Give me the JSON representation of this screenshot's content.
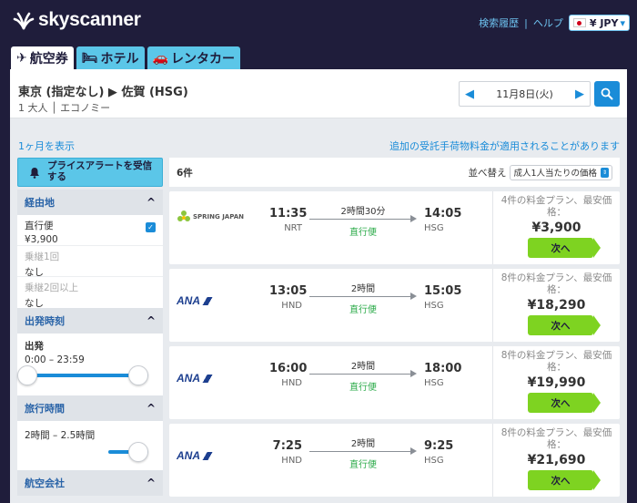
{
  "header": {
    "logo_text": "skyscanner",
    "links": [
      "検索履歴",
      "ヘルプ"
    ],
    "currency": "¥ JPY",
    "currency_caret": "▾"
  },
  "tabs": [
    {
      "label": "航空券",
      "icon": "airplane-icon",
      "glyph": "✈"
    },
    {
      "label": "ホテル",
      "icon": "bed-icon",
      "glyph": "🛏"
    },
    {
      "label": "レンタカー",
      "icon": "car-icon",
      "glyph": "🚗"
    }
  ],
  "search": {
    "route": "東京 (指定なし) ▶ 佐賀 (HSG)",
    "passengers": "1 大人 │ エコノミー",
    "date": "11月8日(火)",
    "prev": "◀",
    "next": "▶"
  },
  "links": {
    "month_view": "1ヶ月を表示",
    "baggage_note": "追加の受託手荷物料金が適用されることがあります"
  },
  "sidebar": {
    "alert_button": "プライスアラートを受信する",
    "stops": {
      "title": "経由地",
      "caret": "^",
      "options": [
        {
          "label": "直行便",
          "price": "¥3,900",
          "checked": true,
          "disabled": false
        },
        {
          "label": "乗継1回",
          "price": "なし",
          "checked": false,
          "disabled": true
        },
        {
          "label": "乗継2回以上",
          "price": "なし",
          "checked": false,
          "disabled": true
        }
      ]
    },
    "departure": {
      "title": "出発時刻",
      "caret": "^",
      "label": "出発",
      "range": "0:00 – 23:59"
    },
    "duration": {
      "title": "旅行時間",
      "caret": "^",
      "range": "2時間 – 2.5時間"
    },
    "airlines": {
      "title": "航空会社",
      "caret": "^"
    }
  },
  "results": {
    "count": "6件",
    "sort_label": "並べ替え",
    "sort_value": "成人1人当たりの価格",
    "flights": [
      {
        "airline": "SPRING JAPAN",
        "airline_logo": "spring",
        "dep_time": "11:35",
        "dep_code": "NRT",
        "duration": "2時間30分",
        "stops": "直行便",
        "arr_time": "14:05",
        "arr_code": "HSG",
        "plans": "4件の料金プラン、最安価格：",
        "price": "¥3,900",
        "button": "次へ"
      },
      {
        "airline": "ANA",
        "airline_logo": "ana",
        "dep_time": "13:05",
        "dep_code": "HND",
        "duration": "2時間",
        "stops": "直行便",
        "arr_time": "15:05",
        "arr_code": "HSG",
        "plans": "8件の料金プラン、最安価格：",
        "price": "¥18,290",
        "button": "次へ"
      },
      {
        "airline": "ANA",
        "airline_logo": "ana",
        "dep_time": "16:00",
        "dep_code": "HND",
        "duration": "2時間",
        "stops": "直行便",
        "arr_time": "18:00",
        "arr_code": "HSG",
        "plans": "8件の料金プラン、最安価格：",
        "price": "¥19,990",
        "button": "次へ"
      },
      {
        "airline": "ANA",
        "airline_logo": "ana",
        "dep_time": "7:25",
        "dep_code": "HND",
        "duration": "2時間",
        "stops": "直行便",
        "arr_time": "9:25",
        "arr_code": "HSG",
        "plans": "8件の料金プラン、最安価格：",
        "price": "¥21,690",
        "button": "次へ"
      }
    ]
  }
}
